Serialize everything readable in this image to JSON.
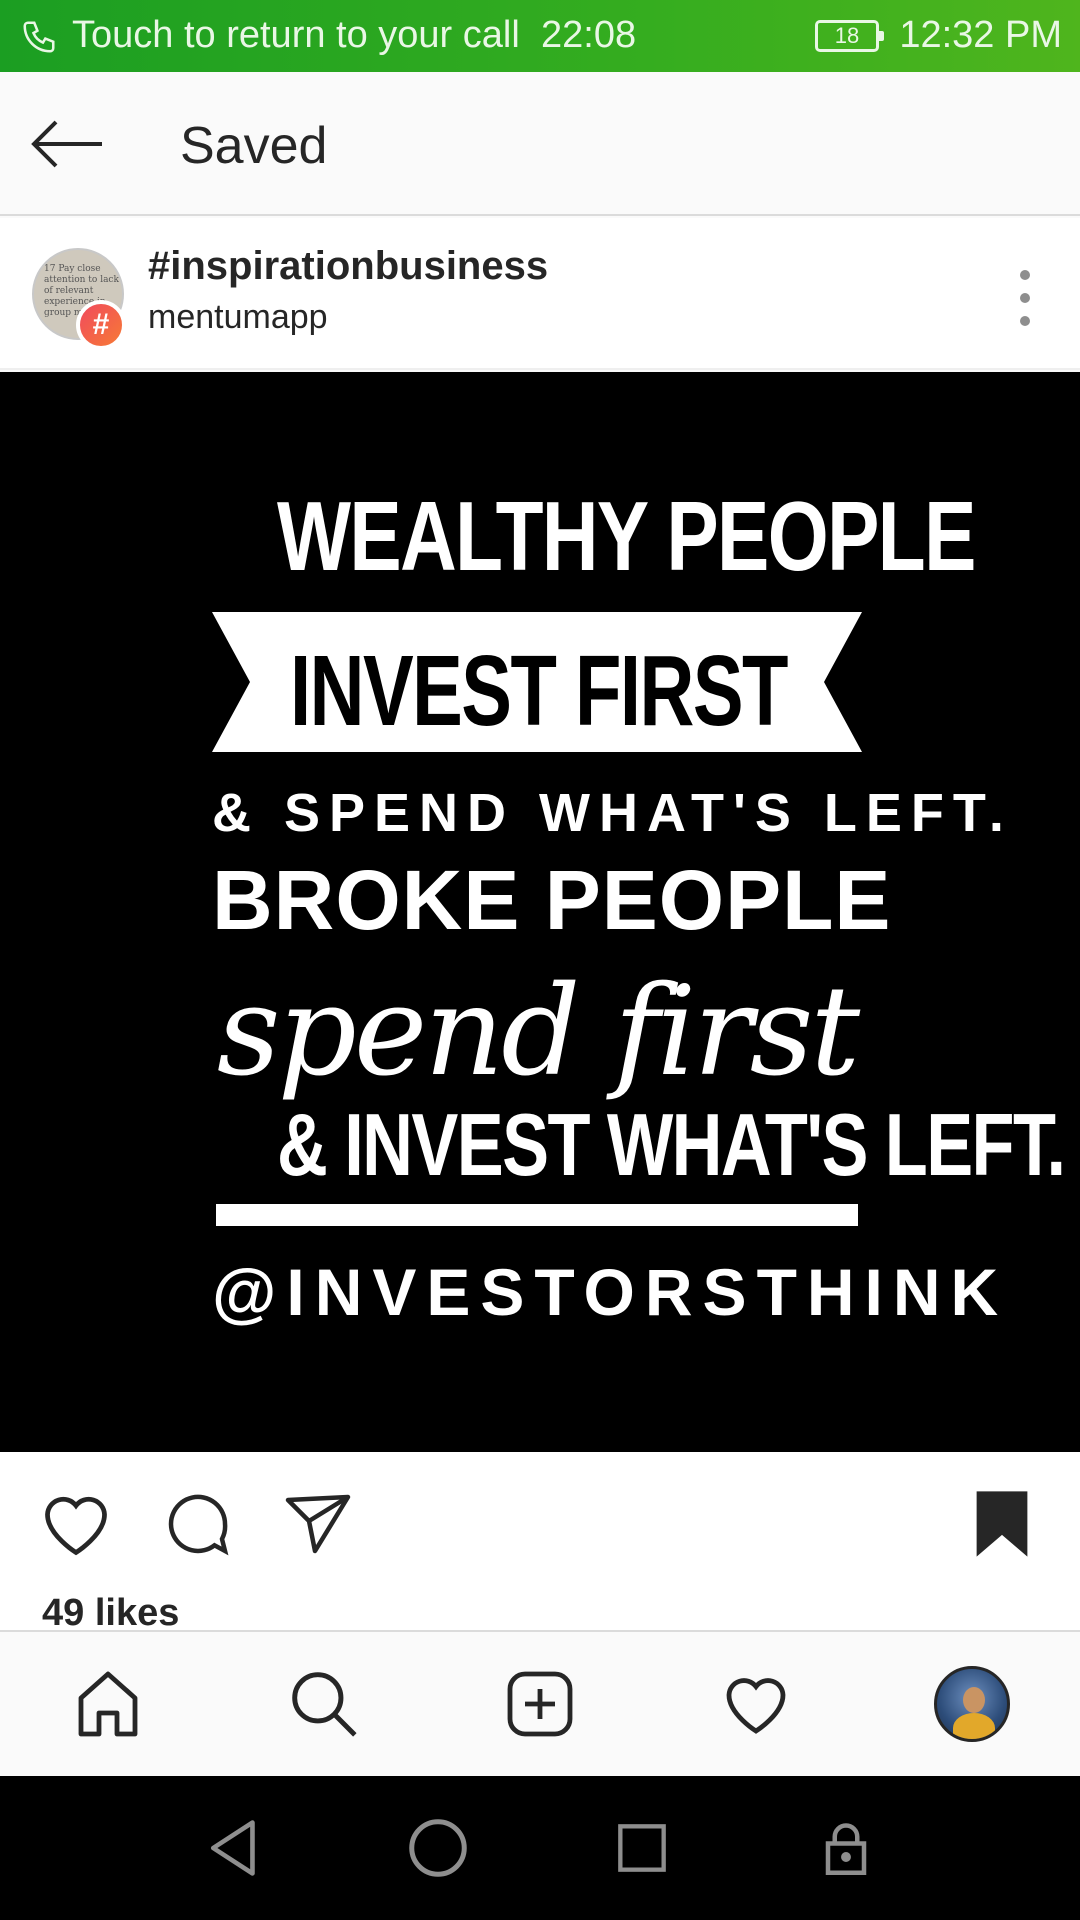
{
  "status_bar": {
    "call_banner": "Touch to return to your call",
    "call_timer": "22:08",
    "battery": "18",
    "clock": "12:32 PM"
  },
  "header": {
    "title": "Saved",
    "back_icon": "arrow-left-icon"
  },
  "post": {
    "hashtag": "#inspirationbusiness",
    "account": "mentumapp",
    "avatar_badge": "#",
    "avatar_thumb_text": "17 Pay close attention to lack of relevant experience in group m...",
    "image_text": {
      "line1": "WEALTHY PEOPLE",
      "line2": "INVEST FIRST",
      "line3": "& SPEND WHAT'S LEFT.",
      "line4": "BROKE PEOPLE",
      "line5": "spend first",
      "line6": "& INVEST WHAT'S LEFT.",
      "line7": "@INVESTORSTHINK"
    },
    "likes": "49 likes",
    "actions": [
      "heart-icon",
      "comment-icon",
      "share-icon",
      "bookmark-icon"
    ]
  },
  "bottom_nav": [
    "home-icon",
    "search-icon",
    "add-post-icon",
    "activity-heart-icon",
    "profile-avatar"
  ],
  "system_nav": [
    "back-triangle-icon",
    "home-circle-icon",
    "recents-square-icon",
    "lock-icon"
  ],
  "colors": {
    "status_green": "#2ea61f",
    "text_dark": "#262626",
    "badge_gradient_start": "#f04a5e",
    "badge_gradient_end": "#f77a35"
  }
}
